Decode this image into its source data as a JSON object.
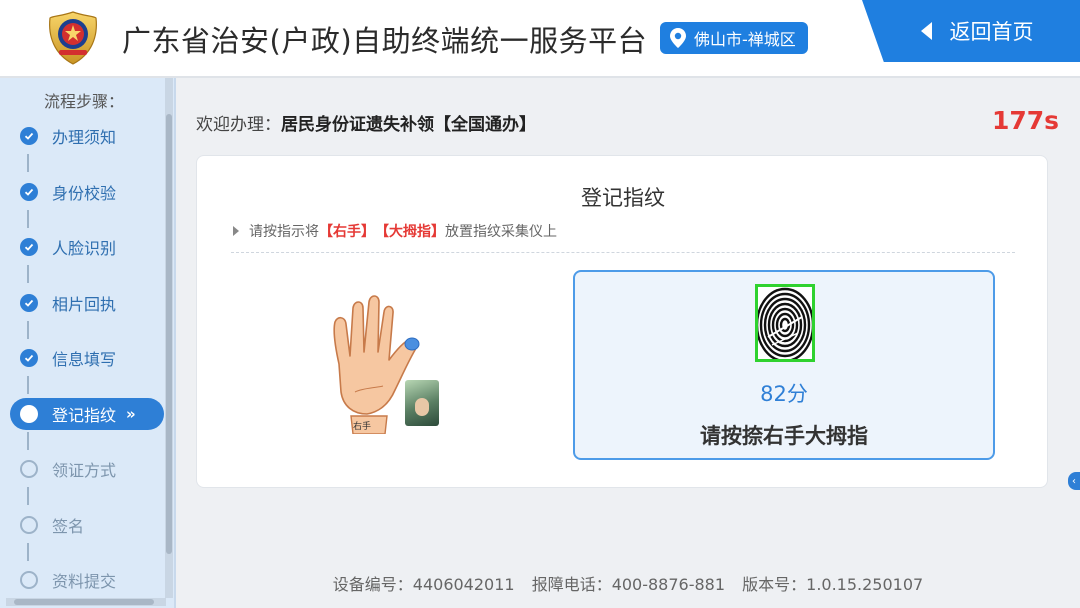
{
  "header": {
    "title": "广东省治安(户政)自助终端统一服务平台",
    "location": "佛山市-禅城区",
    "back_label": "返回首页"
  },
  "sidebar": {
    "steps_label": "流程步骤：",
    "steps": [
      {
        "label": "办理须知",
        "status": "done"
      },
      {
        "label": "身份校验",
        "status": "done"
      },
      {
        "label": "人脸识别",
        "status": "done"
      },
      {
        "label": "相片回执",
        "status": "done"
      },
      {
        "label": "信息填写",
        "status": "done"
      },
      {
        "label": "登记指纹",
        "status": "active"
      },
      {
        "label": "领证方式",
        "status": "todo"
      },
      {
        "label": "签名",
        "status": "todo"
      },
      {
        "label": "资料提交",
        "status": "todo"
      }
    ],
    "active_arrows": "»"
  },
  "main": {
    "welcome_prefix": "欢迎办理：",
    "service_name": "居民身份证遗失补领【全国通办】",
    "countdown": "177s",
    "card_title": "登记指纹",
    "instruction": {
      "part1": "请按指示将",
      "hand": "【右手】",
      "finger": "【大拇指】",
      "part2": "放置指纹采集仪上"
    },
    "hand_caption": "右手",
    "score": "82分",
    "prompt": "请按捺右手大拇指"
  },
  "footer": {
    "device": "设备编号：4406042011",
    "hotline": "报障电话：400-8876-881",
    "version": "版本号：1.0.15.250107"
  },
  "colors": {
    "primary": "#1f7fe0",
    "sidebar_bg": "#dbe9f8",
    "countdown": "#e53935",
    "fingerprint_frame": "#2fd22f"
  }
}
